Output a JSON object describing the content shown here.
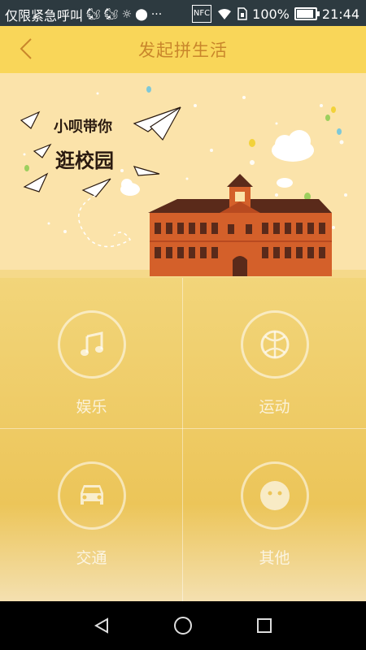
{
  "status_bar": {
    "carrier": "仅限紧急呼叫",
    "battery_percent": "100%",
    "time": "21:44",
    "icons": [
      "squirrel-icon",
      "squirrel-icon",
      "brightness-icon",
      "location-icon",
      "more-icon",
      "nfc-icon",
      "wifi-icon",
      "sim-icon",
      "battery-icon"
    ]
  },
  "header": {
    "title": "发起拼生活",
    "back_icon": "back-chevron-icon"
  },
  "banner": {
    "line1": "小呗带你",
    "line2": "逛校园"
  },
  "categories": [
    {
      "label": "娱乐",
      "icon": "music-note-icon"
    },
    {
      "label": "运动",
      "icon": "basketball-icon"
    },
    {
      "label": "交通",
      "icon": "car-icon"
    },
    {
      "label": "其他",
      "icon": "smiley-face-icon"
    }
  ],
  "colors": {
    "header_bg": "#f9d659",
    "title": "#c9862b",
    "banner_bg": "#fbe3aa",
    "grid_bg": "#ecc559",
    "status_bg": "#2d3a40"
  },
  "nav_bar": {
    "icons": [
      "back-triangle-icon",
      "home-circle-icon",
      "recents-square-icon"
    ]
  }
}
